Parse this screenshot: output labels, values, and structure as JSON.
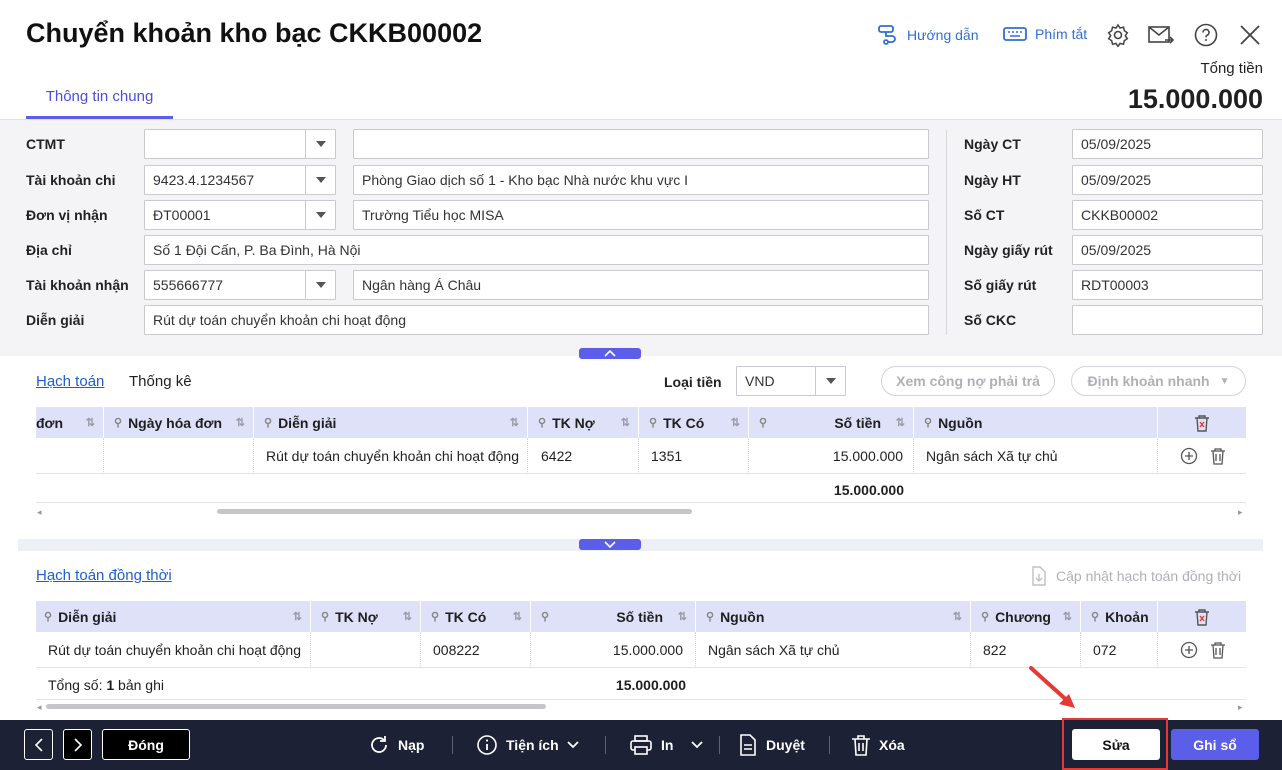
{
  "header": {
    "title": "Chuyển khoản kho bạc CKKB00002",
    "help_label": "Hướng dẫn",
    "shortcut_label": "Phím tắt",
    "tab_label": "Thông tin chung",
    "total_label": "Tổng tiền",
    "total_value": "15.000.000"
  },
  "form": {
    "ctmt_label": "CTMT",
    "ctmt_value": "",
    "ctmt_desc": "",
    "tk_chi_label": "Tài khoản chi",
    "tk_chi_value": "9423.4.1234567",
    "tk_chi_desc": "Phòng Giao dịch số 1 - Kho bạc Nhà nước khu vực I",
    "don_vi_label": "Đơn vị nhận",
    "don_vi_value": "ĐT00001",
    "don_vi_desc": "Trường Tiểu học MISA",
    "dia_chi_label": "Địa chỉ",
    "dia_chi_value": "Số 1 Đội Cấn, P. Ba Đình, Hà Nội",
    "tk_nhan_label": "Tài khoản nhận",
    "tk_nhan_value": "555666777",
    "tk_nhan_desc": "Ngân hàng Á Châu",
    "dien_giai_label": "Diễn giải",
    "dien_giai_value": "Rút dự toán chuyển khoản chi hoạt động",
    "ngay_ct_label": "Ngày CT",
    "ngay_ct_value": "05/09/2025",
    "ngay_ht_label": "Ngày HT",
    "ngay_ht_value": "05/09/2025",
    "so_ct_label": "Số CT",
    "so_ct_value": "CKKB00002",
    "ngay_gr_label": "Ngày giấy rút",
    "ngay_gr_value": "05/09/2025",
    "so_gr_label": "Số giấy rút",
    "so_gr_value": "RDT00003",
    "so_ckc_label": "Số CKC",
    "so_ckc_value": ""
  },
  "ledger": {
    "tab_hach_toan": "Hạch toán",
    "tab_thong_ke": "Thống kê",
    "currency_label": "Loại tiền",
    "currency_value": "VND",
    "btn_cong_no": "Xem công nợ phải trả",
    "btn_dinh_khoan": "Định khoản nhanh",
    "columns": [
      "đơn",
      "Ngày hóa đơn",
      "Diễn giải",
      "TK Nợ",
      "TK Có",
      "Số tiền",
      "Nguồn"
    ],
    "row": [
      "",
      "",
      "Rút dự toán chuyển khoản chi hoạt động",
      "6422",
      "1351",
      "15.000.000",
      "Ngân sách Xã tự chủ"
    ],
    "sum": "15.000.000"
  },
  "concurrent": {
    "title": "Hạch toán đồng thời",
    "update_btn": "Cập nhật hạch toán đồng thời",
    "columns": [
      "Diễn giải",
      "TK Nợ",
      "TK Có",
      "Số tiền",
      "Nguồn",
      "Chương",
      "Khoản"
    ],
    "row": [
      "Rút dự toán chuyển khoản chi hoạt động",
      "",
      "008222",
      "15.000.000",
      "Ngân sách Xã tự chủ",
      "822",
      "072"
    ],
    "count_prefix": "Tổng số: ",
    "count_value": "1",
    "count_suffix": " bản ghi",
    "sum": "15.000.000"
  },
  "footer": {
    "close": "Đóng",
    "reload": "Nạp",
    "utilities": "Tiện ích",
    "print": "In",
    "approve": "Duyệt",
    "delete": "Xóa",
    "edit": "Sửa",
    "post": "Ghi sổ"
  },
  "colors": {
    "accent": "#5b5ee8",
    "footer_bg": "#1c2136",
    "highlight": "#e53935"
  }
}
